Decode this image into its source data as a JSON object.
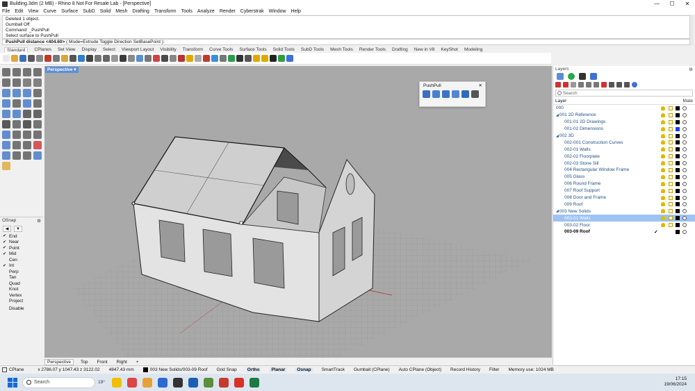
{
  "window": {
    "title": "Building.3dm (2 MB) - Rhino 8 Not For Resale Lab - [Perspective]",
    "min": "—",
    "max": "☐",
    "close": "✕"
  },
  "menu": [
    "File",
    "Edit",
    "View",
    "Curve",
    "Surface",
    "SubD",
    "Solid",
    "Mesh",
    "Drafting",
    "Transform",
    "Tools",
    "Analyze",
    "Render",
    "Cyberstrak",
    "Window",
    "Help"
  ],
  "command_history": [
    "Deleted 1 object.",
    "Gumball Off",
    "Command: _PushPull",
    "Select surface to PushPull"
  ],
  "command_prompt": {
    "label": "PushPull distance <404.60>",
    "options": "( Mode=Extrude  Toggle  Direction  SetBasePoint ):"
  },
  "toolbar_tabs": [
    "Standard",
    "CPlanes",
    "Set View",
    "Display",
    "Select",
    "Viewport Layout",
    "Visibility",
    "Transform",
    "Curve Tools",
    "Surface Tools",
    "Solid Tools",
    "SubD Tools",
    "Mesh Tools",
    "Render Tools",
    "Drafting",
    "New in V8",
    "KeyShot",
    "Modeling"
  ],
  "toolbar_icon_colors": [
    "#e8e8e8",
    "#e1a73a",
    "#3b6fb6",
    "#5a5a5a",
    "#888",
    "#c0392b",
    "#777",
    "#d6a63c",
    "#555",
    "#2e7fcf",
    "#444",
    "#777",
    "#666",
    "#999",
    "#3a3a3a",
    "#8a8a8a",
    "#5a8fd0",
    "#777",
    "#c44",
    "#4a4a4a",
    "#888",
    "#b83232",
    "#e0a800",
    "#aaa",
    "#c0392b",
    "#3d8fd6",
    "#777",
    "#2a9d4b",
    "#333",
    "#555",
    "#e0a800",
    "#e0a800",
    "#222",
    "#2f9c3f",
    "#3f6fd8"
  ],
  "left_tool_colors": [
    "#555",
    "#555",
    "#555",
    "#555",
    "#555",
    "#555",
    "#666",
    "#666",
    "#3e74c8",
    "#3e74c8",
    "#3e74c8",
    "#555",
    "#3e74c8",
    "#555",
    "#3e74c8",
    "#555",
    "#3e74c8",
    "#3e74c8",
    "#444",
    "#444",
    "#333",
    "#555",
    "#333",
    "#555",
    "#3e74c8",
    "#555",
    "#555",
    "#555",
    "#3e74c8",
    "#555",
    "#555",
    "#c33",
    "#3e74c8",
    "#555",
    "#555",
    "#3e74c8",
    "#e1a73a"
  ],
  "osnap": {
    "title": "OSnap",
    "items": [
      {
        "label": "End",
        "checked": true
      },
      {
        "label": "Near",
        "checked": true
      },
      {
        "label": "Point",
        "checked": true
      },
      {
        "label": "Mid",
        "checked": true
      },
      {
        "label": "Cen",
        "checked": false
      },
      {
        "label": "Int",
        "checked": true
      },
      {
        "label": "Perp",
        "checked": false
      },
      {
        "label": "Tan",
        "checked": false
      },
      {
        "label": "Quad",
        "checked": false
      },
      {
        "label": "Knot",
        "checked": false
      },
      {
        "label": "Vertex",
        "checked": false
      },
      {
        "label": "Project",
        "checked": false
      }
    ],
    "disable": "Disable"
  },
  "viewport": {
    "label": "Perspective"
  },
  "pushpull_panel": {
    "title": "PushPull",
    "icon_colors": [
      "#3a6fc4",
      "#4a7fd0",
      "#3e74c8",
      "#5586d4",
      "#2e6ac0",
      "#555"
    ]
  },
  "viewport_tabs": [
    "Perspective",
    "Top",
    "Front",
    "Right",
    "+"
  ],
  "layers": {
    "title": "Layers",
    "search_placeholder": "Search",
    "col_layer": "Layer",
    "col_material": "Mate",
    "rows": [
      {
        "name": "000",
        "indent": 0,
        "arrow": "",
        "sel": false,
        "cur": false,
        "swatch": "#000000"
      },
      {
        "name": "001 2D Reference",
        "indent": 0,
        "arrow": "◢",
        "sel": false,
        "cur": false,
        "swatch": "#000000"
      },
      {
        "name": "001-01 2D Drawings",
        "indent": 2,
        "arrow": "",
        "sel": false,
        "cur": false,
        "swatch": "#000000"
      },
      {
        "name": "001-02 Dimensions",
        "indent": 2,
        "arrow": "",
        "sel": false,
        "cur": false,
        "swatch": "#1a3cff"
      },
      {
        "name": "002 3D",
        "indent": 0,
        "arrow": "◢",
        "sel": false,
        "cur": false,
        "swatch": "#000000"
      },
      {
        "name": "002-001 Construction Curves",
        "indent": 2,
        "arrow": "",
        "sel": false,
        "cur": false,
        "swatch": "#000000"
      },
      {
        "name": "002-01 Walls",
        "indent": 2,
        "arrow": "",
        "sel": false,
        "cur": false,
        "swatch": "#000000"
      },
      {
        "name": "002-02 Floorplate",
        "indent": 2,
        "arrow": "",
        "sel": false,
        "cur": false,
        "swatch": "#000000"
      },
      {
        "name": "002-03 Stone Sill",
        "indent": 2,
        "arrow": "",
        "sel": false,
        "cur": false,
        "swatch": "#000000"
      },
      {
        "name": "004 Rectangular Window Frame",
        "indent": 2,
        "arrow": "",
        "sel": false,
        "cur": false,
        "swatch": "#000000"
      },
      {
        "name": "005 Glass",
        "indent": 2,
        "arrow": "",
        "sel": false,
        "cur": false,
        "swatch": "#000000"
      },
      {
        "name": "006 Round Frame",
        "indent": 2,
        "arrow": "",
        "sel": false,
        "cur": false,
        "swatch": "#000000"
      },
      {
        "name": "007 Roof Support",
        "indent": 2,
        "arrow": "",
        "sel": false,
        "cur": false,
        "swatch": "#000000"
      },
      {
        "name": "008 Door and Frame",
        "indent": 2,
        "arrow": "",
        "sel": false,
        "cur": false,
        "swatch": "#000000"
      },
      {
        "name": "009 Roof",
        "indent": 2,
        "arrow": "",
        "sel": false,
        "cur": false,
        "swatch": "#000000"
      },
      {
        "name": "003 New Solids",
        "indent": 0,
        "arrow": "◢",
        "sel": false,
        "cur": false,
        "swatch": "#000000"
      },
      {
        "name": "003-01 Walls",
        "indent": 2,
        "arrow": "",
        "sel": true,
        "cur": false,
        "swatch": "#000000"
      },
      {
        "name": "003-02 Floor",
        "indent": 2,
        "arrow": "",
        "sel": false,
        "cur": false,
        "swatch": "#000000"
      },
      {
        "name": "003-09 Roof",
        "indent": 2,
        "arrow": "",
        "sel": false,
        "cur": true,
        "swatch": "#000000"
      }
    ]
  },
  "status": {
    "cplane": "CPlane",
    "coords": "x 2786.07  y 1047.43  z 3122.02",
    "units": "4847.43 mm",
    "layer": "003 New Solids/003-09 Roof",
    "items": [
      "Grid Snap",
      "Ortho",
      "Planar",
      "Osnap",
      "SmartTrack",
      "Gumball (CPlane)",
      "Auto CPlane (Object)",
      "Record History",
      "Filter",
      "Memory use: 1024 MB"
    ],
    "active": [
      "Ortho",
      "Planar",
      "Osnap"
    ]
  },
  "taskbar": {
    "search": "Search",
    "weather": "19°",
    "app_colors": [
      "#f0c000",
      "#d44",
      "#e8a13a",
      "#2a6bd1",
      "#333",
      "#1a5fb4",
      "#5a8f3c",
      "#c43a2c",
      "#d93025",
      "#1d7a44"
    ],
    "time": "17:15",
    "date": "19/06/2024"
  }
}
